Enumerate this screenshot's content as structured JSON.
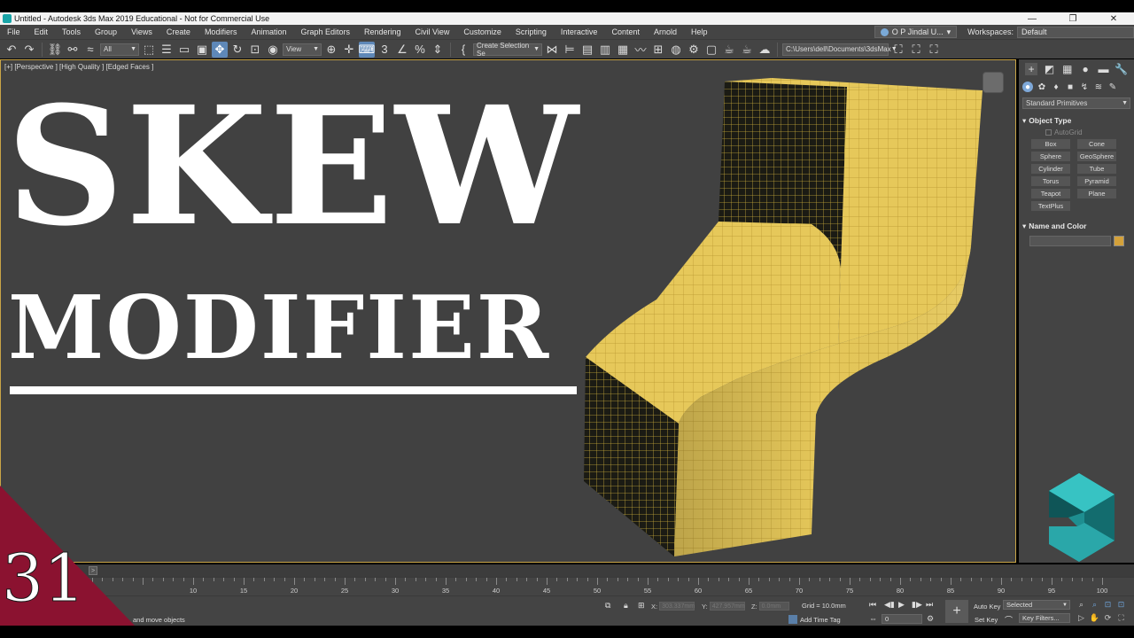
{
  "window": {
    "title": "Untitled - Autodesk 3ds Max 2019 Educational - Not for Commercial Use",
    "controls": [
      "—",
      "❐",
      "✕"
    ]
  },
  "menu": {
    "items": [
      "File",
      "Edit",
      "Tools",
      "Group",
      "Views",
      "Create",
      "Modifiers",
      "Animation",
      "Graph Editors",
      "Rendering",
      "Civil View",
      "Customize",
      "Scripting",
      "Interactive",
      "Content",
      "Arnold",
      "Help"
    ],
    "user": "O P Jindal U...",
    "workspaces_label": "Workspaces:",
    "workspaces_value": "Default"
  },
  "toolbar": {
    "selection_filter": "All",
    "ref_coord": "View",
    "named_selection": "Create Selection Se",
    "project_path": "C:\\Users\\dell\\Documents\\3dsMax"
  },
  "viewport": {
    "label": "[+] [Perspective ] [High Quality ] [Edged Faces ]",
    "overlay_title": "SKEW",
    "overlay_subtitle": "MODIFIER",
    "mesh_color": "#e6c85a",
    "mesh_dark": "#1b1b14",
    "border_color": "#c9a547"
  },
  "command_panel": {
    "category": "Standard Primitives",
    "object_type_title": "Object Type",
    "autogrid_label": "AutoGrid",
    "primitives": [
      "Box",
      "Cone",
      "Sphere",
      "GeoSphere",
      "Cylinder",
      "Tube",
      "Torus",
      "Pyramid",
      "Teapot",
      "Plane",
      "TextPlus"
    ],
    "name_color_title": "Name and Color",
    "object_color": "#d4a13a"
  },
  "timeslider": {
    "ticks": [
      10,
      15,
      20,
      25,
      30,
      35,
      40,
      45,
      50,
      55,
      60,
      65,
      70,
      75,
      80,
      85,
      90,
      95,
      100
    ],
    "knob_label": ">"
  },
  "status": {
    "prompt": "and move objects",
    "x_label": "X:",
    "x_value": "303.337mm",
    "y_label": "Y:",
    "y_value": "427.957mm",
    "z_label": "Z:",
    "z_value": "0.0mm",
    "grid": "Grid = 10.0mm",
    "add_time_tag": "Add Time Tag",
    "frame": "0",
    "auto_key": "Auto Key",
    "set_key": "Set Key",
    "selected": "Selected",
    "key_filters": "Key Filters..."
  },
  "badge": {
    "number": "31",
    "color": "#8b1230"
  }
}
